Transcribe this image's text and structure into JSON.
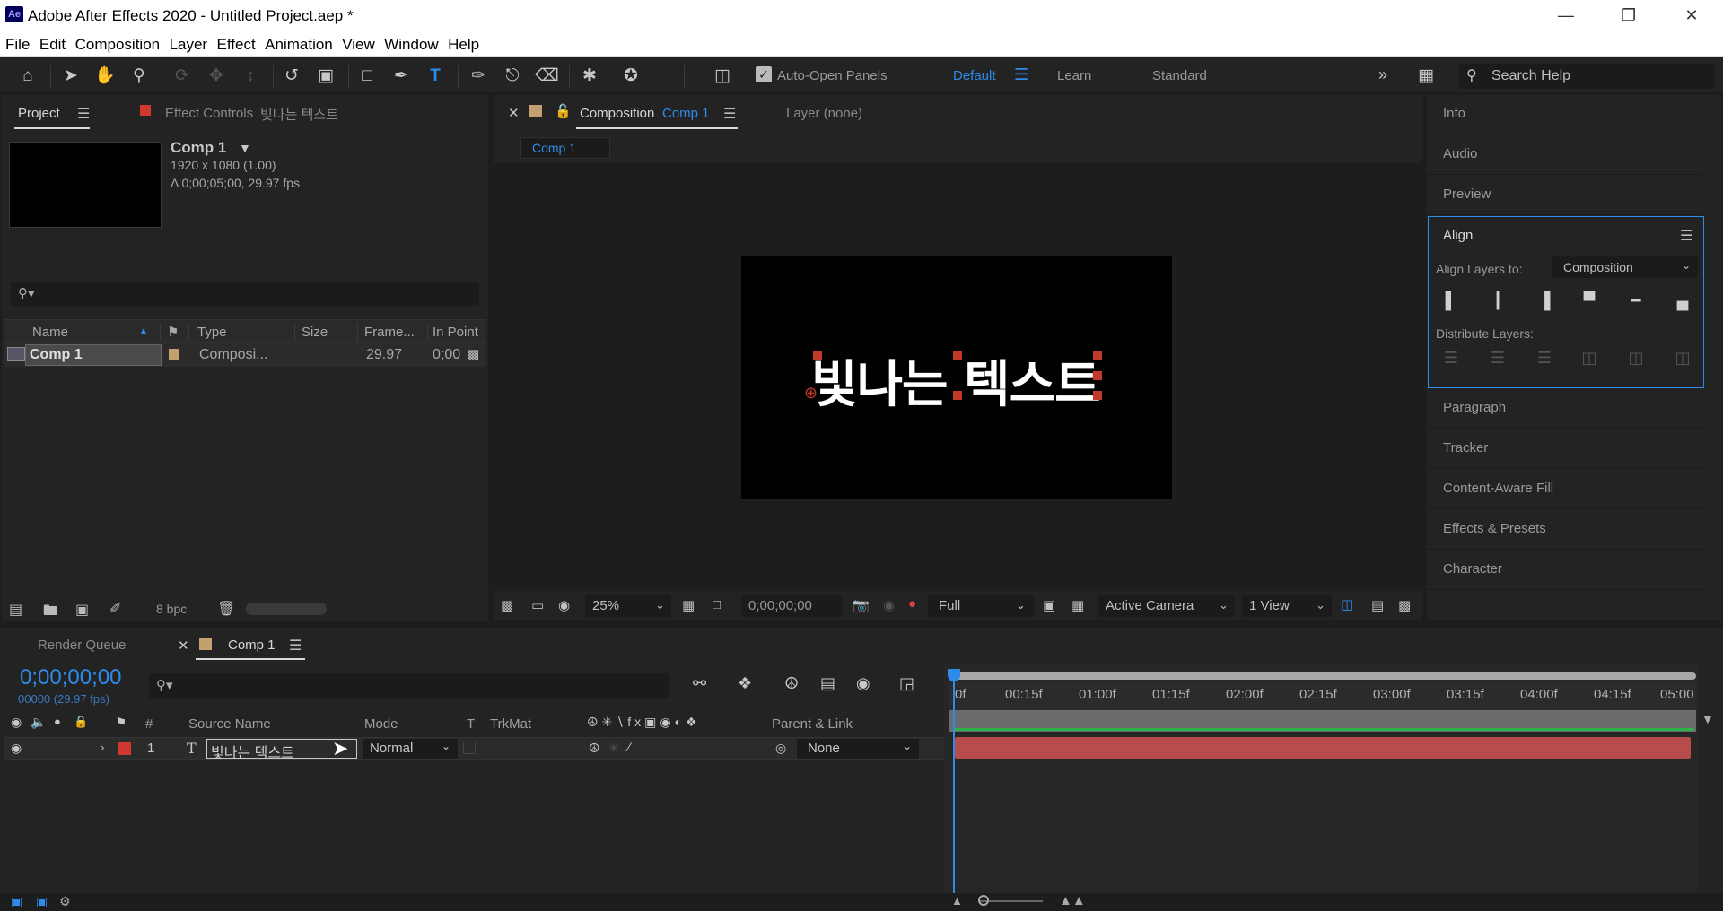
{
  "window": {
    "title": "Adobe After Effects 2020 - Untitled Project.aep *",
    "logo": "Ae"
  },
  "menu": [
    "File",
    "Edit",
    "Composition",
    "Layer",
    "Effect",
    "Animation",
    "View",
    "Window",
    "Help"
  ],
  "toolbar": {
    "auto_open_panels": "Auto-Open Panels",
    "workspaces": {
      "default": "Default",
      "learn": "Learn",
      "standard": "Standard"
    },
    "search_help_placeholder": "Search Help"
  },
  "project_panel": {
    "tab_project": "Project",
    "tab_effect_controls": "Effect Controls",
    "effect_controls_target": "빛나는 텍스트",
    "comp_name": "Comp 1",
    "comp_resolution": "1920 x 1080 (1.00)",
    "comp_duration": "Δ 0;00;05;00, 29.97 fps",
    "columns": [
      "Name",
      "Type",
      "Size",
      "Frame...",
      "In Point"
    ],
    "items": [
      {
        "name": "Comp 1",
        "type": "Composi...",
        "size": "",
        "frame_rate": "29.97",
        "in_point": "0;00"
      }
    ],
    "bit_depth": "8 bpc"
  },
  "viewer": {
    "tab_label": "Composition",
    "tab_comp": "Comp 1",
    "layer_tab": "Layer (none)",
    "subtab": "Comp 1",
    "canvas_text": "빛나는 텍스트",
    "zoom": "25%",
    "timecode": "0;00;00;00",
    "resolution": "Full",
    "camera": "Active Camera",
    "views": "1 View"
  },
  "right_panels": {
    "info": "Info",
    "audio": "Audio",
    "preview": "Preview",
    "align": {
      "title": "Align",
      "align_layers_to_label": "Align Layers to:",
      "align_layers_to_value": "Composition",
      "distribute_label": "Distribute Layers:"
    },
    "paragraph": "Paragraph",
    "tracker": "Tracker",
    "content_aware_fill": "Content-Aware Fill",
    "effects_presets": "Effects & Presets",
    "character": "Character"
  },
  "timeline": {
    "tab_render_queue": "Render Queue",
    "tab_comp": "Comp 1",
    "timecode": "0;00;00;00",
    "frame_info": "00000 (29.97 fps)",
    "columns": {
      "num": "#",
      "source_name": "Source Name",
      "mode": "Mode",
      "t": "T",
      "trkmat": "TrkMat",
      "parent": "Parent & Link"
    },
    "layer": {
      "index": "1",
      "type_icon": "T",
      "name": "빛나는 텍스트",
      "mode": "Normal",
      "parent": "None"
    },
    "ruler_labels": [
      "0f",
      "00:15f",
      "01:00f",
      "01:15f",
      "02:00f",
      "02:15f",
      "03:00f",
      "03:15f",
      "04:00f",
      "04:15f",
      "05:00"
    ]
  },
  "colors": {
    "accent": "#2d8ceb",
    "layer_label": "#b84b4b",
    "label_red": "#d0372f",
    "comp_label": "#c2a070"
  }
}
